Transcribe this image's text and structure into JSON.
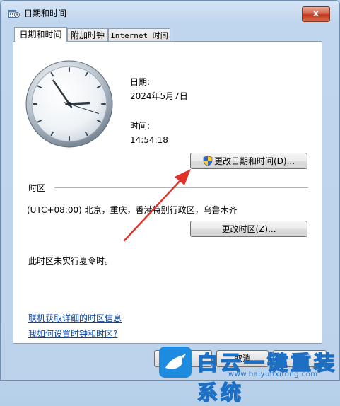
{
  "window": {
    "title": "日期和时间",
    "close_label": "x"
  },
  "tabs": [
    {
      "label": "日期和时间",
      "active": true
    },
    {
      "label": "附加时钟",
      "active": false
    },
    {
      "label": "Internet 时间",
      "active": false
    }
  ],
  "date": {
    "label": "日期:",
    "value": "2024年5月7日"
  },
  "time": {
    "label": "时间:",
    "value": "14:54:18"
  },
  "clock": {
    "hour": 14,
    "minute": 54,
    "second": 18
  },
  "buttons": {
    "change_datetime": "更改日期和时间(D)...",
    "change_timezone": "更改时区(Z)..."
  },
  "timezone": {
    "heading": "时区",
    "value": "(UTC+08:00) 北京，重庆，香港特别行政区，乌鲁木齐",
    "dst_note": "此时区未实行夏令时。"
  },
  "links": {
    "online_info": "联机获取详细的时区信息",
    "how_to": "我如何设置时钟和时区?"
  },
  "footer": {
    "ok_label": "",
    "cancel_label": "取消",
    "apply_label": ""
  },
  "watermark": {
    "brand": "白云一键重装系统",
    "url": "www.baiyunxitong.com"
  },
  "colors": {
    "arrow": "#e0322b",
    "link": "#0645ad",
    "watermark": "#1d8be0"
  }
}
